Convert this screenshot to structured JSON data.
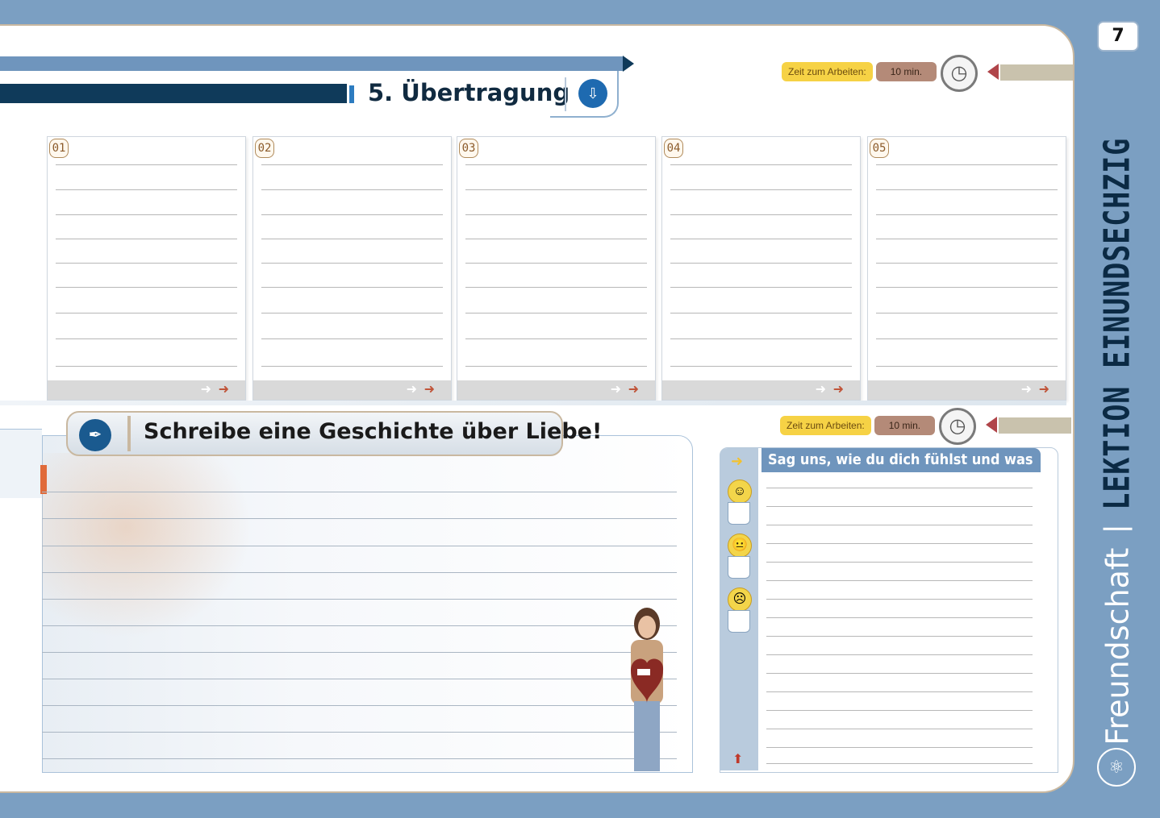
{
  "page_number": "7",
  "side": {
    "subtitle": "Freundschaft",
    "title": "LEKTION EINUNDSECHZIG"
  },
  "header": {
    "title": "5. Übertragung",
    "icon": "download-list-icon"
  },
  "timer_top": {
    "label": "Zeit zum Arbeiten:",
    "value": "10 min."
  },
  "timer_bottom": {
    "label": "Zeit zum Arbeiten:",
    "value": "10 min."
  },
  "boxes": [
    {
      "number": "01"
    },
    {
      "number": "02"
    },
    {
      "number": "03"
    },
    {
      "number": "04"
    },
    {
      "number": "05"
    }
  ],
  "writing": {
    "title": "Schreibe eine Geschichte über Liebe!",
    "icon": "pen-nib-icon"
  },
  "reflection": {
    "header": "Sag uns, wie du dich fühlst und was du gelernt hast !",
    "icons": [
      "happy-face-icon",
      "neutral-face-icon",
      "sad-face-icon"
    ]
  },
  "colors": {
    "page_bg": "#7b9fc2",
    "dark_navy": "#0f3a5a",
    "accent_blue": "#6f95bd",
    "timer_yellow": "#f6d245",
    "timer_brown": "#b48a78"
  }
}
